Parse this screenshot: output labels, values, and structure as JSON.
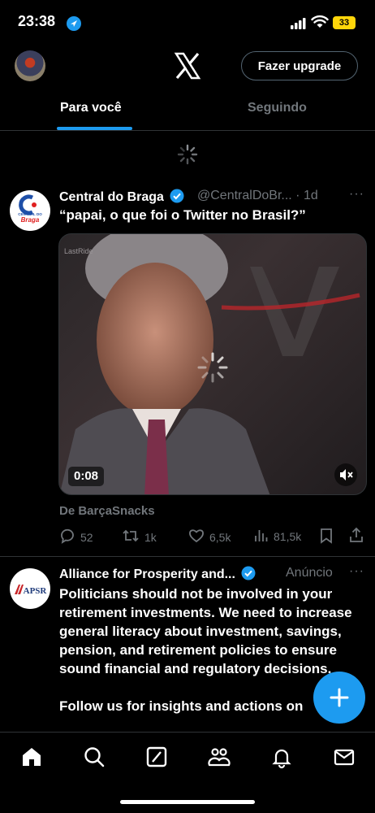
{
  "status": {
    "time": "23:38",
    "battery": "33"
  },
  "header": {
    "upgrade_label": "Fazer upgrade"
  },
  "tabs": [
    {
      "label": "Para você"
    },
    {
      "label": "Seguindo"
    }
  ],
  "tweet1": {
    "name": "Central do Braga",
    "handle": "@CentralDoBr... · 1d",
    "text": "“papai, o que foi o Twitter no Brasil?”",
    "avatar_text_top": "CENTRAL DO",
    "avatar_text_bottom": "Braga",
    "media_watermark": "LastRide",
    "duration": "0:08",
    "from": "De BarçaSnacks",
    "replies": "52",
    "retweets": "1k",
    "likes": "6,5k",
    "views": "81,5k"
  },
  "tweet2": {
    "name": "Alliance for Prosperity and...",
    "ad_label": "Anúncio",
    "avatar_text": "APSR",
    "text": "Politicians should not be involved in your retirement investments. We need to increase general literacy about investment, savings, pension, and retirement policies to ensure sound financial and regulatory decisions.\n\nFollow us for insights and actions on"
  },
  "colors": {
    "accent": "#1d9bf0",
    "muted": "#71767b",
    "battery": "#ffd60a"
  },
  "icons": [
    "location-arrow-icon",
    "signal-icon",
    "wifi-icon",
    "x-logo-icon",
    "verified-icon",
    "more-icon",
    "reply-icon",
    "retweet-icon",
    "like-icon",
    "views-icon",
    "bookmark-icon",
    "share-icon",
    "mute-icon",
    "compose-icon",
    "home-icon",
    "search-icon",
    "grok-icon",
    "communities-icon",
    "notifications-icon",
    "messages-icon"
  ]
}
